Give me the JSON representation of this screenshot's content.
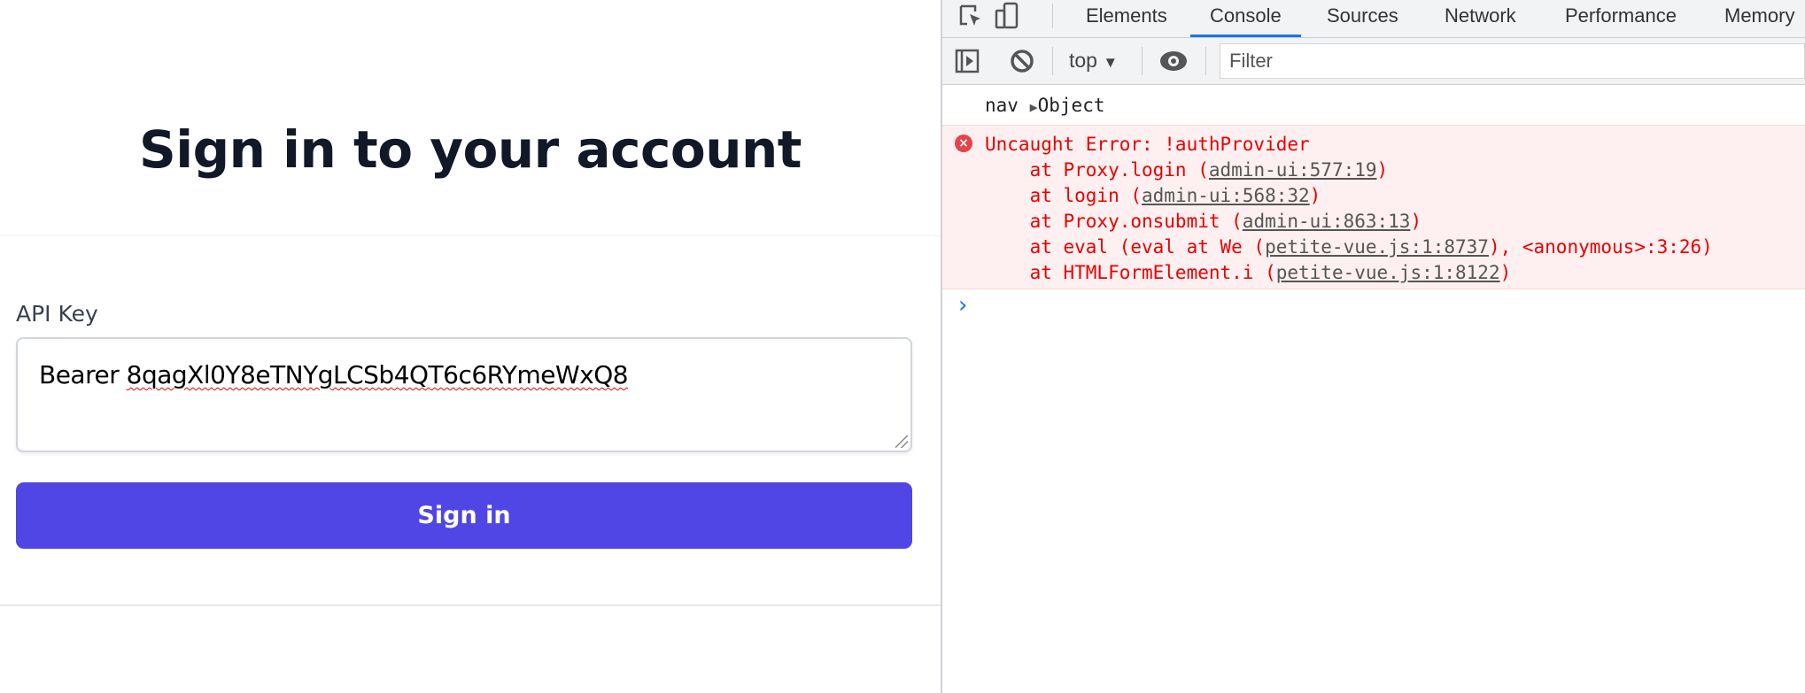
{
  "page": {
    "title": "Sign in to your account",
    "api_key_label": "API Key",
    "api_key_prefix": "Bearer ",
    "api_key_token": "8qagXl0Y8eTNYgLCSb4QT6c6RYmeWxQ8",
    "sign_in_label": "Sign in",
    "accent_color": "#4f46e5"
  },
  "devtools": {
    "tabs": [
      {
        "label": "Elements"
      },
      {
        "label": "Console",
        "active": true
      },
      {
        "label": "Sources"
      },
      {
        "label": "Network"
      },
      {
        "label": "Performance"
      },
      {
        "label": "Memory"
      }
    ],
    "context": "top",
    "filter_placeholder": "Filter",
    "console": {
      "nav_log": {
        "label": "nav",
        "value": "Object"
      },
      "error": {
        "message": "Uncaught Error: !authProvider",
        "stack": [
          {
            "pre": "    at Proxy.login (",
            "link": "admin-ui:577:19",
            "post": ")"
          },
          {
            "pre": "    at login (",
            "link": "admin-ui:568:32",
            "post": ")"
          },
          {
            "pre": "    at Proxy.onsubmit (",
            "link": "admin-ui:863:13",
            "post": ")"
          },
          {
            "pre": "    at eval (eval at We (",
            "link": "petite-vue.js:1:8737",
            "post": "), <anonymous>:3:26)"
          },
          {
            "pre": "    at HTMLFormElement.i (",
            "link": "petite-vue.js:1:8122",
            "post": ")"
          }
        ]
      },
      "prompt_icon": "chevron-right-icon"
    }
  }
}
